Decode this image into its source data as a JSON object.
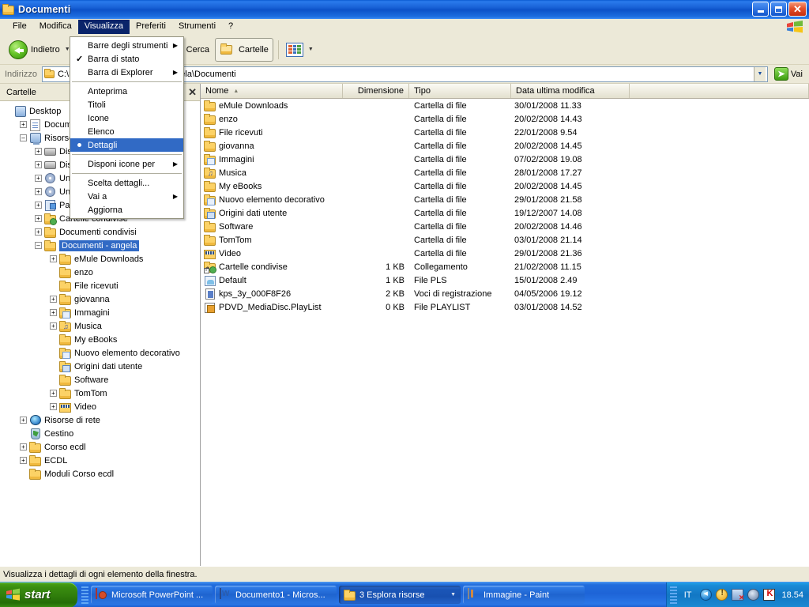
{
  "window": {
    "title": "Documenti",
    "icon": "folder-documents-icon",
    "buttons": {
      "minimize": "Riduci a icona",
      "maximize": "Ingrandisci",
      "close": "Chiudi"
    }
  },
  "menubar": {
    "items": [
      {
        "label": "File",
        "active": false
      },
      {
        "label": "Modifica",
        "active": false
      },
      {
        "label": "Visualizza",
        "active": true
      },
      {
        "label": "Preferiti",
        "active": false
      },
      {
        "label": "Strumenti",
        "active": false
      },
      {
        "label": "?",
        "active": false
      }
    ]
  },
  "dropdown": {
    "open_for": "Visualizza",
    "items": [
      {
        "label": "Barre degli strumenti",
        "submenu": true,
        "checked": false,
        "radio": false,
        "selected": false
      },
      {
        "label": "Barra di stato",
        "submenu": false,
        "checked": true,
        "radio": false,
        "selected": false
      },
      {
        "label": "Barra di Explorer",
        "submenu": true,
        "checked": false,
        "radio": false,
        "selected": false
      },
      {
        "separator": true
      },
      {
        "label": "Anteprima",
        "submenu": false,
        "checked": false,
        "radio": false,
        "selected": false
      },
      {
        "label": "Titoli",
        "submenu": false,
        "checked": false,
        "radio": false,
        "selected": false
      },
      {
        "label": "Icone",
        "submenu": false,
        "checked": false,
        "radio": false,
        "selected": false
      },
      {
        "label": "Elenco",
        "submenu": false,
        "checked": false,
        "radio": false,
        "selected": false
      },
      {
        "label": "Dettagli",
        "submenu": false,
        "checked": false,
        "radio": true,
        "selected": true
      },
      {
        "separator": true
      },
      {
        "label": "Disponi icone per",
        "submenu": true,
        "checked": false,
        "radio": false,
        "selected": false
      },
      {
        "separator": true
      },
      {
        "label": "Scelta dettagli...",
        "submenu": false,
        "checked": false,
        "radio": false,
        "selected": false
      },
      {
        "label": "Vai a",
        "submenu": true,
        "checked": false,
        "radio": false,
        "selected": false
      },
      {
        "label": "Aggiorna",
        "submenu": false,
        "checked": false,
        "radio": false,
        "selected": false
      }
    ]
  },
  "toolbar": {
    "back_label": "Indietro",
    "search_label": "Cerca",
    "folders_label": "Cartelle",
    "views_label": "Visualizza"
  },
  "address": {
    "label": "Indirizzo",
    "value": "C:\\Documents and Settings\\angela\\Documenti",
    "value_visible_start": "C:\\",
    "value_visible_end": "la\\Documenti",
    "go_label": "Vai"
  },
  "sidebar": {
    "header": "Cartelle",
    "close_label": "✕",
    "tree": [
      {
        "label": "Desktop",
        "depth": 0,
        "expander": "none",
        "icon": "desktop-icon",
        "selected": false
      },
      {
        "label": "Documenti",
        "depth": 1,
        "expander": "plus",
        "icon": "documents-icon",
        "selected": false
      },
      {
        "label": "Risorse del computer",
        "depth": 1,
        "expander": "minus",
        "icon": "my-computer-icon",
        "selected": false
      },
      {
        "label": "Disco locale (C:)",
        "depth": 2,
        "expander": "plus",
        "icon": "hard-disk-icon",
        "selected": false
      },
      {
        "label": "Disco locale (D:)",
        "depth": 2,
        "expander": "plus",
        "icon": "hard-disk-icon",
        "selected": false
      },
      {
        "label": "Unità CD (E:)",
        "depth": 2,
        "expander": "plus",
        "icon": "cd-drive-icon",
        "selected": false
      },
      {
        "label": "Unità CD (F:)",
        "depth": 2,
        "expander": "plus",
        "icon": "cd-drive-icon",
        "selected": false
      },
      {
        "label": "Pannello di controllo",
        "depth": 2,
        "expander": "plus",
        "icon": "control-panel-icon",
        "selected": false
      },
      {
        "label": "Cartelle condivise",
        "depth": 2,
        "expander": "plus",
        "icon": "shared-folder-icon",
        "selected": false
      },
      {
        "label": "Documenti condivisi",
        "depth": 2,
        "expander": "plus",
        "icon": "folder-icon",
        "selected": false
      },
      {
        "label": "Documenti - angela",
        "depth": 2,
        "expander": "minus",
        "icon": "folder-icon",
        "selected": true
      },
      {
        "label": "eMule Downloads",
        "depth": 3,
        "expander": "plus",
        "icon": "folder-icon",
        "selected": false
      },
      {
        "label": "enzo",
        "depth": 3,
        "expander": "none",
        "icon": "folder-icon",
        "selected": false
      },
      {
        "label": "File ricevuti",
        "depth": 3,
        "expander": "none",
        "icon": "folder-icon",
        "selected": false
      },
      {
        "label": "giovanna",
        "depth": 3,
        "expander": "plus",
        "icon": "folder-icon",
        "selected": false
      },
      {
        "label": "Immagini",
        "depth": 3,
        "expander": "plus",
        "icon": "pictures-folder-icon",
        "selected": false
      },
      {
        "label": "Musica",
        "depth": 3,
        "expander": "plus",
        "icon": "music-folder-icon",
        "selected": false
      },
      {
        "label": "My eBooks",
        "depth": 3,
        "expander": "none",
        "icon": "folder-icon",
        "selected": false
      },
      {
        "label": "Nuovo elemento decorativo",
        "depth": 3,
        "expander": "none",
        "icon": "pictures-folder-icon",
        "selected": false
      },
      {
        "label": "Origini dati utente",
        "depth": 3,
        "expander": "none",
        "icon": "data-source-folder-icon",
        "selected": false
      },
      {
        "label": "Software",
        "depth": 3,
        "expander": "none",
        "icon": "folder-icon",
        "selected": false
      },
      {
        "label": "TomTom",
        "depth": 3,
        "expander": "plus",
        "icon": "folder-icon",
        "selected": false
      },
      {
        "label": "Video",
        "depth": 3,
        "expander": "plus",
        "icon": "video-folder-icon",
        "selected": false
      },
      {
        "label": "Risorse di rete",
        "depth": 1,
        "expander": "plus",
        "icon": "network-icon",
        "selected": false
      },
      {
        "label": "Cestino",
        "depth": 1,
        "expander": "none",
        "icon": "recycle-bin-icon",
        "selected": false
      },
      {
        "label": "Corso ecdl",
        "depth": 1,
        "expander": "plus",
        "icon": "folder-icon",
        "selected": false
      },
      {
        "label": "ECDL",
        "depth": 1,
        "expander": "plus",
        "icon": "folder-icon",
        "selected": false
      },
      {
        "label": "Moduli Corso ecdl",
        "depth": 1,
        "expander": "none",
        "icon": "folder-icon",
        "selected": false
      }
    ]
  },
  "filelist": {
    "columns": [
      {
        "label": "Nome",
        "sorted": "asc",
        "align": "left"
      },
      {
        "label": "Dimensione",
        "sorted": "",
        "align": "right"
      },
      {
        "label": "Tipo",
        "sorted": "",
        "align": "left"
      },
      {
        "label": "Data ultima modifica",
        "sorted": "",
        "align": "left"
      }
    ],
    "rows": [
      {
        "name": "eMule Downloads",
        "size": "",
        "type": "Cartella di file",
        "date": "30/01/2008 11.33",
        "icon": "folder-icon"
      },
      {
        "name": "enzo",
        "size": "",
        "type": "Cartella di file",
        "date": "20/02/2008 14.43",
        "icon": "folder-icon"
      },
      {
        "name": "File ricevuti",
        "size": "",
        "type": "Cartella di file",
        "date": "22/01/2008 9.54",
        "icon": "folder-icon"
      },
      {
        "name": "giovanna",
        "size": "",
        "type": "Cartella di file",
        "date": "20/02/2008 14.45",
        "icon": "folder-icon"
      },
      {
        "name": "Immagini",
        "size": "",
        "type": "Cartella di file",
        "date": "07/02/2008 19.08",
        "icon": "pictures-folder-icon"
      },
      {
        "name": "Musica",
        "size": "",
        "type": "Cartella di file",
        "date": "28/01/2008 17.27",
        "icon": "music-folder-icon"
      },
      {
        "name": "My eBooks",
        "size": "",
        "type": "Cartella di file",
        "date": "20/02/2008 14.45",
        "icon": "folder-icon"
      },
      {
        "name": "Nuovo elemento decorativo",
        "size": "",
        "type": "Cartella di file",
        "date": "29/01/2008 21.58",
        "icon": "pictures-folder-icon"
      },
      {
        "name": "Origini dati utente",
        "size": "",
        "type": "Cartella di file",
        "date": "19/12/2007 14.08",
        "icon": "data-source-folder-icon"
      },
      {
        "name": "Software",
        "size": "",
        "type": "Cartella di file",
        "date": "20/02/2008 14.46",
        "icon": "folder-icon"
      },
      {
        "name": "TomTom",
        "size": "",
        "type": "Cartella di file",
        "date": "03/01/2008 21.14",
        "icon": "folder-icon"
      },
      {
        "name": "Video",
        "size": "",
        "type": "Cartella di file",
        "date": "29/01/2008 21.36",
        "icon": "video-folder-icon"
      },
      {
        "name": "Cartelle condivise",
        "size": "1 KB",
        "type": "Collegamento",
        "date": "21/02/2008 11.15",
        "icon": "shared-folder-shortcut-icon"
      },
      {
        "name": "Default",
        "size": "1 KB",
        "type": "File PLS",
        "date": "15/01/2008 2.49",
        "icon": "pls-file-icon"
      },
      {
        "name": "kps_3y_000F8F26",
        "size": "2 KB",
        "type": "Voci di registrazione",
        "date": "04/05/2006 19.12",
        "icon": "registry-file-icon"
      },
      {
        "name": "PDVD_MediaDisc.PlayList",
        "size": "0 KB",
        "type": "File PLAYLIST",
        "date": "03/01/2008 14.52",
        "icon": "playlist-file-icon"
      }
    ]
  },
  "statusbar": {
    "text": "Visualizza i dettagli di ogni elemento della finestra."
  },
  "taskbar": {
    "start_label": "start",
    "tasks": [
      {
        "label": "Microsoft PowerPoint ...",
        "icon": "powerpoint-icon",
        "active": false,
        "group": false
      },
      {
        "label": "Documento1 - Micros...",
        "icon": "word-icon",
        "active": false,
        "group": false
      },
      {
        "label": "3 Esplora risorse",
        "icon": "folder-icon",
        "active": true,
        "group": true
      },
      {
        "label": "Immagine - Paint",
        "icon": "paint-icon",
        "active": false,
        "group": false
      }
    ],
    "tray": {
      "language": "IT",
      "icons": [
        "back-arrow-icon",
        "security-alert-icon",
        "network-disconnected-icon",
        "volume-icon",
        "kaspersky-icon"
      ],
      "clock": "18.54"
    }
  },
  "colors": {
    "titlebar_blue": "#0c52c8",
    "selection_blue": "#316ac5",
    "menu_highlight": "#0a246a",
    "window_bg": "#ece9d8",
    "taskbar_blue": "#216ddd",
    "start_green": "#3a8d10"
  }
}
